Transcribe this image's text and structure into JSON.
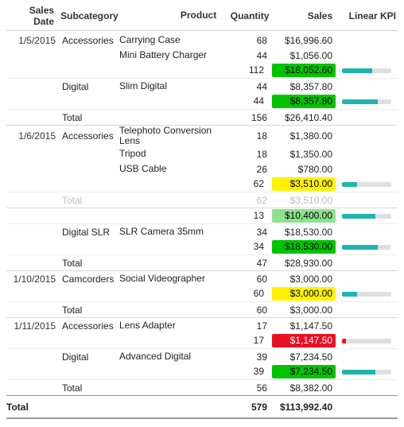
{
  "colors": {
    "green": "#00C400",
    "lightgreen": "#8DE28D",
    "yellow": "#FFF100",
    "red": "#E81123",
    "teal": "#1FB5AD"
  },
  "headers": {
    "date": "Sales Date",
    "subcat": "Subcategory",
    "product": "Product",
    "qty": "Quantity",
    "sales": "Sales",
    "kpi": "Linear KPI"
  },
  "groups": [
    {
      "date": "1/5/2015",
      "subcats": [
        {
          "name": "Accessories",
          "rows": [
            {
              "product": "Carrying Case",
              "qty": "68",
              "sales": "$16,996.60"
            },
            {
              "product": "Mini Battery Charger",
              "qty": "44",
              "sales": "$1,056.00"
            }
          ],
          "subtotal": {
            "qty": "112",
            "sales": "$18,052.60",
            "fill": "green",
            "kpi": 0.62
          }
        },
        {
          "name": "Digital",
          "rows": [
            {
              "product": "Slim Digital",
              "qty": "44",
              "sales": "$8,357.80"
            }
          ],
          "subtotal": {
            "qty": "44",
            "sales": "$8,357.80",
            "fill": "green",
            "kpi": 0.72
          }
        }
      ],
      "total": {
        "label": "Total",
        "qty": "156",
        "sales": "$26,410.40"
      }
    },
    {
      "date": "1/6/2015",
      "subcats": [
        {
          "name": "Accessories",
          "rows": [
            {
              "product": "Telephoto Conversion Lens",
              "qty": "18",
              "sales": "$1,380.00"
            },
            {
              "product": "Tripod",
              "qty": "18",
              "sales": "$1,350.00"
            },
            {
              "product": "USB Cable",
              "qty": "26",
              "sales": "$780.00"
            }
          ],
          "subtotal": {
            "qty": "62",
            "sales": "$3,510.00",
            "fill": "yellow",
            "kpi": 0.3
          }
        }
      ],
      "total": {
        "label": "Total",
        "qty": "62",
        "sales": "$3,510.00",
        "faded": true
      }
    },
    {
      "date": "",
      "subcats": [
        {
          "name": "",
          "rows": [],
          "subtotal": {
            "qty": "13",
            "sales": "$10,400.00",
            "fill": "lightgreen",
            "kpi": 0.68
          }
        },
        {
          "name": "Digital SLR",
          "rows": [
            {
              "product": "SLR Camera 35mm",
              "qty": "34",
              "sales": "$18,530.00"
            }
          ],
          "subtotal": {
            "qty": "34",
            "sales": "$18,530.00",
            "fill": "green",
            "kpi": 0.72
          }
        }
      ],
      "total": {
        "label": "Total",
        "qty": "47",
        "sales": "$28,930.00"
      }
    },
    {
      "date": "1/10/2015",
      "subcats": [
        {
          "name": "Camcorders",
          "rows": [
            {
              "product": "Social Videographer",
              "qty": "60",
              "sales": "$3,000.00"
            }
          ],
          "subtotal": {
            "qty": "60",
            "sales": "$3,000.00",
            "fill": "yellow",
            "kpi": 0.3
          }
        }
      ],
      "total": {
        "label": "Total",
        "qty": "60",
        "sales": "$3,000.00"
      }
    },
    {
      "date": "1/11/2015",
      "subcats": [
        {
          "name": "Accessories",
          "rows": [
            {
              "product": "Lens Adapter",
              "qty": "17",
              "sales": "$1,147.50"
            }
          ],
          "subtotal": {
            "qty": "17",
            "sales": "$1,147.50",
            "fill": "red",
            "kpi": 0.08,
            "kpicolor": "red"
          }
        },
        {
          "name": "Digital",
          "rows": [
            {
              "product": "Advanced Digital",
              "qty": "39",
              "sales": "$7,234.50"
            }
          ],
          "subtotal": {
            "qty": "39",
            "sales": "$7,234.50",
            "fill": "green",
            "kpi": 0.68
          }
        }
      ],
      "total": {
        "label": "Total",
        "qty": "56",
        "sales": "$8,382.00"
      }
    }
  ],
  "grand": {
    "label": "Total",
    "qty": "579",
    "sales": "$113,992.40"
  }
}
